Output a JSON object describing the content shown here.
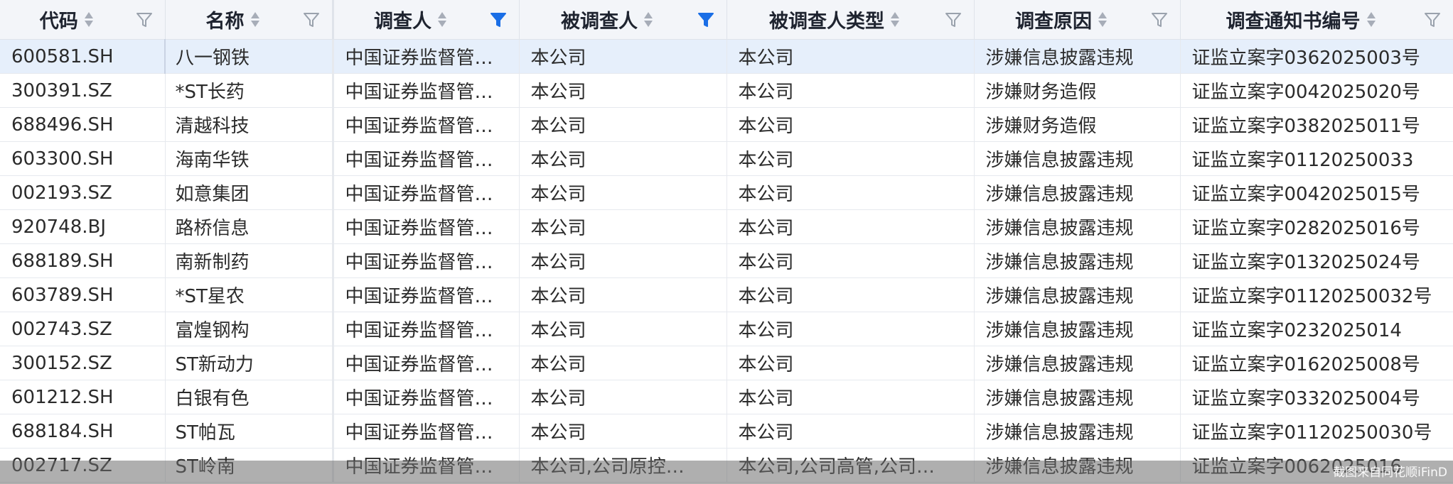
{
  "columns": [
    {
      "label": "代码",
      "sortable": true,
      "filter_active": false
    },
    {
      "label": "名称",
      "sortable": true,
      "filter_active": false
    },
    {
      "label": "调查人",
      "sortable": true,
      "filter_active": true
    },
    {
      "label": "被调查人",
      "sortable": true,
      "filter_active": true
    },
    {
      "label": "被调查人类型",
      "sortable": true,
      "filter_active": false
    },
    {
      "label": "调查原因",
      "sortable": true,
      "filter_active": false
    },
    {
      "label": "调查通知书编号",
      "sortable": true,
      "filter_active": false
    }
  ],
  "rows": [
    {
      "code": "600581.SH",
      "name": "八一钢铁",
      "investigator": "中国证券监督管…",
      "subject": "本公司",
      "subject_type": "本公司",
      "reason": "涉嫌信息披露违规",
      "notice_no": "证监立案字0362025003号"
    },
    {
      "code": "300391.SZ",
      "name": "*ST长药",
      "investigator": "中国证券监督管…",
      "subject": "本公司",
      "subject_type": "本公司",
      "reason": "涉嫌财务造假",
      "notice_no": "证监立案字0042025020号"
    },
    {
      "code": "688496.SH",
      "name": "清越科技",
      "investigator": "中国证券监督管…",
      "subject": "本公司",
      "subject_type": "本公司",
      "reason": "涉嫌财务造假",
      "notice_no": "证监立案字0382025011号"
    },
    {
      "code": "603300.SH",
      "name": "海南华铁",
      "investigator": "中国证券监督管…",
      "subject": "本公司",
      "subject_type": "本公司",
      "reason": "涉嫌信息披露违规",
      "notice_no": "证监立案字01120250033"
    },
    {
      "code": "002193.SZ",
      "name": "如意集团",
      "investigator": "中国证券监督管…",
      "subject": "本公司",
      "subject_type": "本公司",
      "reason": "涉嫌信息披露违规",
      "notice_no": "证监立案字0042025015号"
    },
    {
      "code": "920748.BJ",
      "name": "路桥信息",
      "investigator": "中国证券监督管…",
      "subject": "本公司",
      "subject_type": "本公司",
      "reason": "涉嫌信息披露违规",
      "notice_no": "证监立案字0282025016号"
    },
    {
      "code": "688189.SH",
      "name": "南新制药",
      "investigator": "中国证券监督管…",
      "subject": "本公司",
      "subject_type": "本公司",
      "reason": "涉嫌信息披露违规",
      "notice_no": "证监立案字0132025024号"
    },
    {
      "code": "603789.SH",
      "name": "*ST星农",
      "investigator": "中国证券监督管…",
      "subject": "本公司",
      "subject_type": "本公司",
      "reason": "涉嫌信息披露违规",
      "notice_no": "证监立案字01120250032号"
    },
    {
      "code": "002743.SZ",
      "name": "富煌钢构",
      "investigator": "中国证券监督管…",
      "subject": "本公司",
      "subject_type": "本公司",
      "reason": "涉嫌信息披露违规",
      "notice_no": "证监立案字0232025014"
    },
    {
      "code": "300152.SZ",
      "name": "ST新动力",
      "investigator": "中国证券监督管…",
      "subject": "本公司",
      "subject_type": "本公司",
      "reason": "涉嫌信息披露违规",
      "notice_no": "证监立案字0162025008号"
    },
    {
      "code": "601212.SH",
      "name": "白银有色",
      "investigator": "中国证券监督管…",
      "subject": "本公司",
      "subject_type": "本公司",
      "reason": "涉嫌信息披露违规",
      "notice_no": "证监立案字0332025004号"
    },
    {
      "code": "688184.SH",
      "name": "ST帕瓦",
      "investigator": "中国证券监督管…",
      "subject": "本公司",
      "subject_type": "本公司",
      "reason": "涉嫌信息披露违规",
      "notice_no": "证监立案字01120250030号"
    },
    {
      "code": "002717.SZ",
      "name": "ST岭南",
      "investigator": "中国证券监督管…",
      "subject": "本公司,公司原控…",
      "subject_type": "本公司,公司高管,公司…",
      "reason": "涉嫌信息披露违规",
      "notice_no": "证监立案字0062025016"
    }
  ],
  "selected_row_index": 0,
  "watermark": "截图来自同花顺iFinD",
  "colors": {
    "header_bg": "#f3f5f9",
    "selected_row_bg": "#e6effb",
    "filter_active": "#1a6ee6",
    "filter_inactive": "#9aa2ad"
  },
  "icons": {
    "sort": "sort-icon",
    "filter": "filter-icon"
  }
}
